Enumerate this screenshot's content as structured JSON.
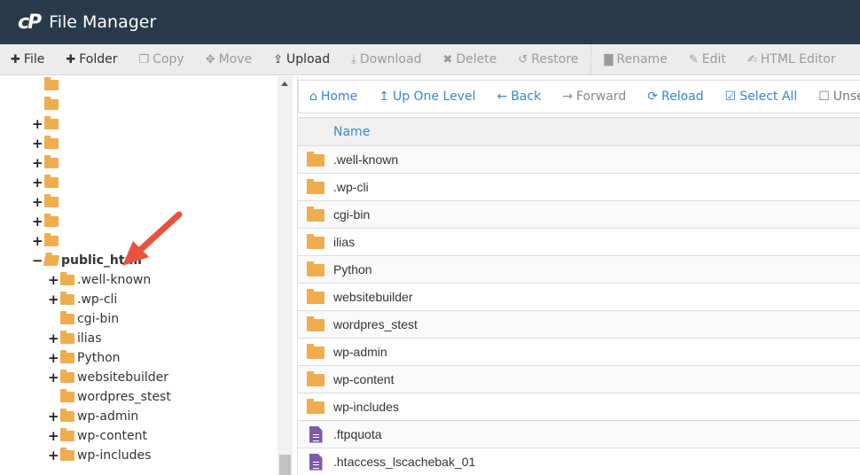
{
  "header": {
    "logo": "cP",
    "title": "File Manager"
  },
  "toolbar": {
    "items": [
      {
        "label": "File",
        "icon": "plus-icon",
        "glyph": "✚",
        "enabled": true
      },
      {
        "label": "Folder",
        "icon": "plus-icon",
        "glyph": "✚",
        "enabled": true
      },
      {
        "label": "Copy",
        "icon": "copy-icon",
        "glyph": "❐",
        "enabled": false
      },
      {
        "label": "Move",
        "icon": "move-icon",
        "glyph": "✥",
        "enabled": false
      },
      {
        "label": "Upload",
        "icon": "upload-icon",
        "glyph": "⇪",
        "enabled": true
      },
      {
        "label": "Download",
        "icon": "download-icon",
        "glyph": "⤓",
        "enabled": false
      },
      {
        "label": "Delete",
        "icon": "delete-icon",
        "glyph": "✖",
        "enabled": false
      },
      {
        "label": "Restore",
        "icon": "restore-icon",
        "glyph": "↺",
        "enabled": false
      },
      {
        "label": "Rename",
        "icon": "rename-icon",
        "glyph": "▇",
        "enabled": false
      },
      {
        "label": "Edit",
        "icon": "pencil-icon",
        "glyph": "✎",
        "enabled": false
      },
      {
        "label": "HTML Editor",
        "icon": "html-editor-icon",
        "glyph": "✍",
        "enabled": false
      }
    ]
  },
  "tree": {
    "items": [
      {
        "label": "",
        "toggle": "",
        "level": 0
      },
      {
        "label": "",
        "toggle": "",
        "level": 0
      },
      {
        "label": "",
        "toggle": "+",
        "level": 0
      },
      {
        "label": "",
        "toggle": "+",
        "level": 0
      },
      {
        "label": "",
        "toggle": "+",
        "level": 0
      },
      {
        "label": "",
        "toggle": "+",
        "level": 0
      },
      {
        "label": "",
        "toggle": "+",
        "level": 0
      },
      {
        "label": "",
        "toggle": "+",
        "level": 0
      },
      {
        "label": "",
        "toggle": "+",
        "level": 0
      },
      {
        "label": "public_html",
        "toggle": "−",
        "level": 0,
        "open": true,
        "bold": true
      },
      {
        "label": ".well-known",
        "toggle": "+",
        "level": 1
      },
      {
        "label": ".wp-cli",
        "toggle": "+",
        "level": 1
      },
      {
        "label": "cgi-bin",
        "toggle": "",
        "level": 1
      },
      {
        "label": "ilias",
        "toggle": "+",
        "level": 1
      },
      {
        "label": "Python",
        "toggle": "+",
        "level": 1
      },
      {
        "label": "websitebuilder",
        "toggle": "+",
        "level": 1
      },
      {
        "label": "wordpres_stest",
        "toggle": "",
        "level": 1
      },
      {
        "label": "wp-admin",
        "toggle": "+",
        "level": 1
      },
      {
        "label": "wp-content",
        "toggle": "+",
        "level": 1
      },
      {
        "label": "wp-includes",
        "toggle": "+",
        "level": 1
      }
    ]
  },
  "nav": {
    "items": [
      {
        "label": "Home",
        "icon": "home-icon",
        "glyph": "⌂",
        "state": "on"
      },
      {
        "label": "Up One Level",
        "icon": "level-up-icon",
        "glyph": "↥",
        "state": "on"
      },
      {
        "label": "Back",
        "icon": "arrow-left-icon",
        "glyph": "←",
        "state": "on"
      },
      {
        "label": "Forward",
        "icon": "arrow-right-icon",
        "glyph": "→",
        "state": "off"
      },
      {
        "label": "Reload",
        "icon": "reload-icon",
        "glyph": "⟳",
        "state": "on"
      },
      {
        "label": "Select All",
        "icon": "checkbox-checked-icon",
        "glyph": "☑",
        "state": "on"
      },
      {
        "label": "Unselect All",
        "icon": "checkbox-empty-icon",
        "glyph": "☐",
        "state": "dim"
      }
    ]
  },
  "table": {
    "columns": [
      "Name"
    ],
    "rows": [
      {
        "name": ".well-known",
        "type": "folder"
      },
      {
        "name": ".wp-cli",
        "type": "folder"
      },
      {
        "name": "cgi-bin",
        "type": "folder"
      },
      {
        "name": "ilias",
        "type": "folder"
      },
      {
        "name": "Python",
        "type": "folder"
      },
      {
        "name": "websitebuilder",
        "type": "folder"
      },
      {
        "name": "wordpres_stest",
        "type": "folder"
      },
      {
        "name": "wp-admin",
        "type": "folder"
      },
      {
        "name": "wp-content",
        "type": "folder"
      },
      {
        "name": "wp-includes",
        "type": "folder"
      },
      {
        "name": ".ftpquota",
        "type": "file"
      },
      {
        "name": ".htaccess_lscachebak_01",
        "type": "file"
      }
    ]
  },
  "colors": {
    "header_bg": "#293a4a",
    "accent": "#3a87c8",
    "folder": "#f0ad4e",
    "file": "#7b5ba6",
    "annotation_arrow": "#e8533f"
  }
}
